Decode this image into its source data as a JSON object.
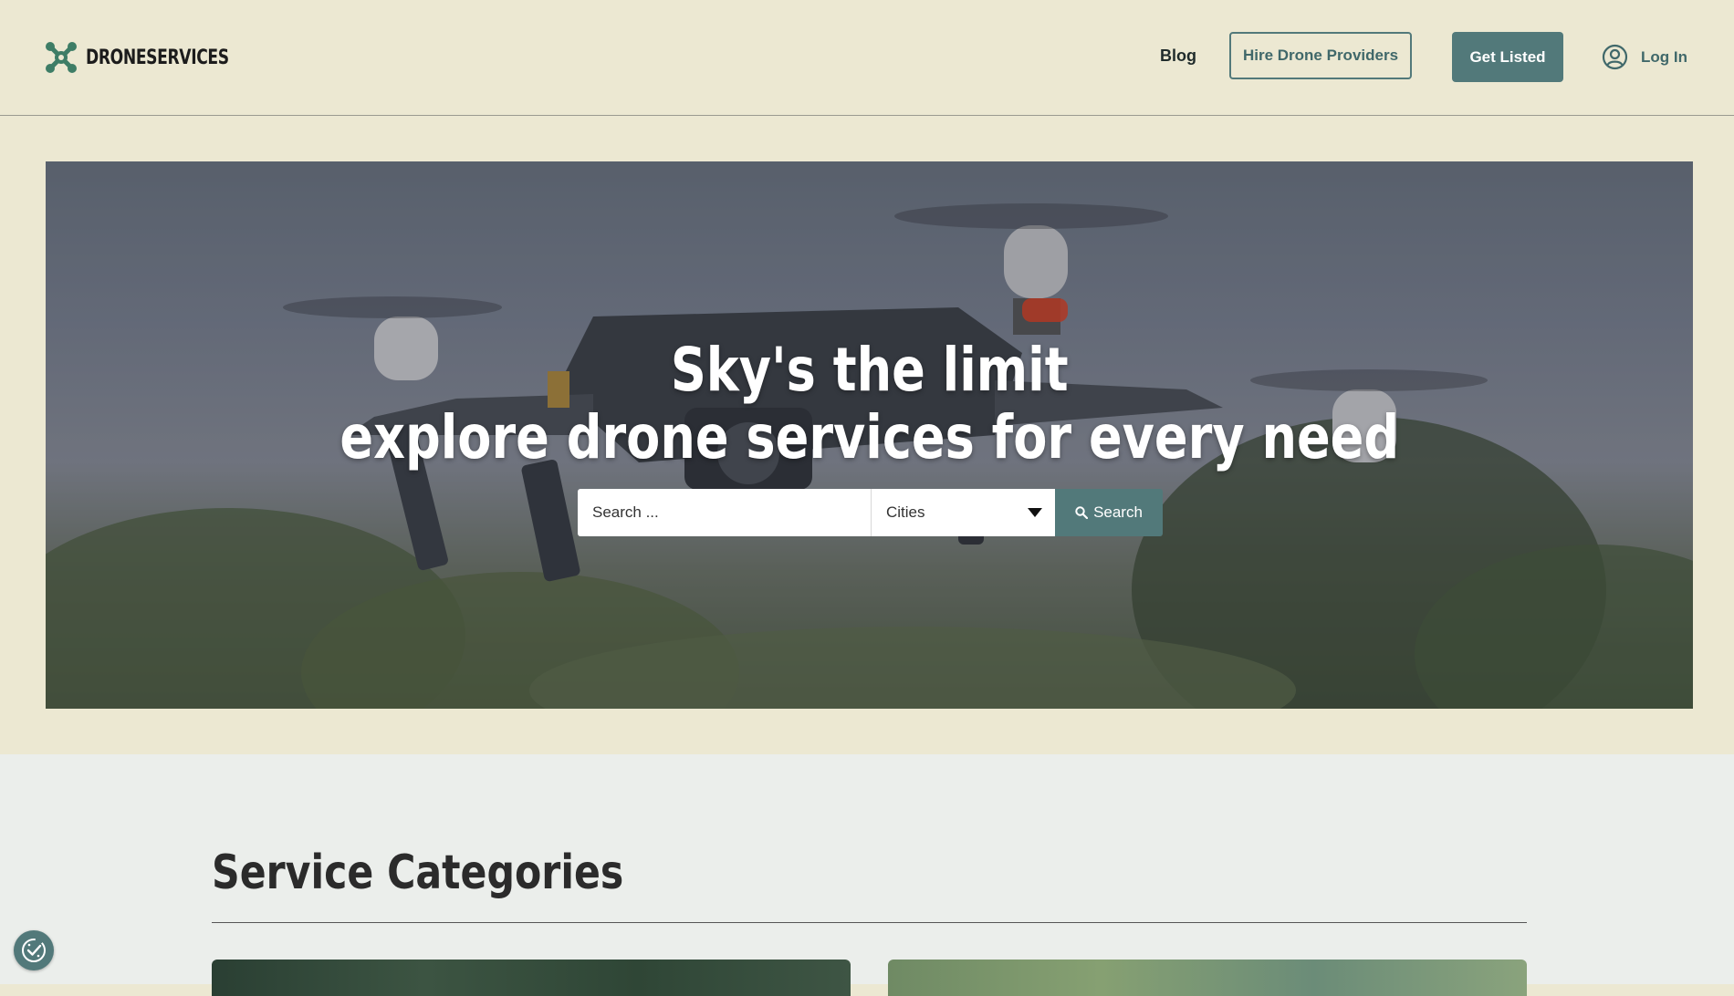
{
  "brand": {
    "name": "DRONESERVICES",
    "accent": "#52797a",
    "logo_color": "#3e7d66"
  },
  "nav": {
    "blog": "Blog",
    "hire": "Hire Drone Providers",
    "get_listed": "Get Listed",
    "login": "Log In"
  },
  "hero": {
    "title_line1": "Sky's the limit",
    "title_line2": "explore drone services for every need",
    "search_placeholder": "Search ...",
    "city_selected": "Cities",
    "search_button": "Search"
  },
  "categories": {
    "title": "Service Categories"
  },
  "icons": {
    "logo": "drone-logo-icon",
    "login": "user-circle-icon",
    "search": "search-icon",
    "dropdown": "caret-down-icon",
    "cookie": "cookie-settings-icon"
  }
}
